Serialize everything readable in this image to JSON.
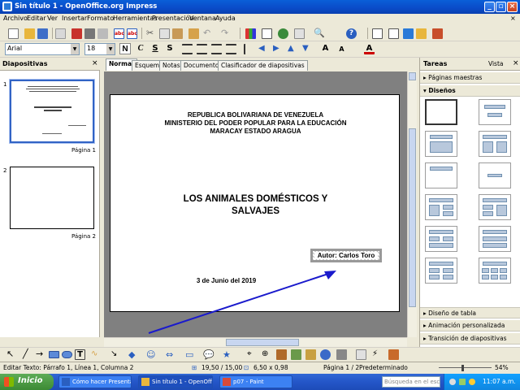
{
  "window": {
    "title": "Sin título 1 - OpenOffice.org Impress"
  },
  "menu": [
    "Archivo",
    "Editar",
    "Ver",
    "Insertar",
    "Formato",
    "Herramientas",
    "Presentación",
    "Ventana",
    "Ayuda"
  ],
  "format_bar": {
    "font_name": "Arial",
    "font_size": "18"
  },
  "slides_pane": {
    "title": "Diapositivas",
    "slides": [
      {
        "number": "1",
        "label": "Página 1"
      },
      {
        "number": "2",
        "label": "Página 2"
      }
    ]
  },
  "view_tabs": [
    "Normal",
    "Esquema",
    "Notas",
    "Documento",
    "Clasificador de diapositivas"
  ],
  "slide": {
    "header_lines": [
      "REPUBLICA BOLIVARIANA DE VENEZUELA",
      "MINISTERIO DEL PODER POPULAR PARA LA EDUCACIÓN",
      "MARACAY ESTADO ARAGUA"
    ],
    "title_lines": [
      "LOS ANIMALES DOMÉSTICOS Y",
      "SALVAJES"
    ],
    "author": "Autor: Carlos Toro",
    "date": "3 de Junio del 2019"
  },
  "task_pane": {
    "title": "Tareas",
    "view_label": "Vista",
    "sections": {
      "master_pages": "Páginas maestras",
      "layouts": "Diseños",
      "table_design": "Diseño de tabla",
      "custom_animation": "Animación personalizada",
      "slide_transition": "Transición de diapositivas"
    }
  },
  "status_bar": {
    "edit_text": "Editar Texto: Párrafo 1, Línea 1, Columna 2",
    "position": "19,50 / 15,00",
    "size": "6,50 x 0,98",
    "page": "Página 1 / 2",
    "style": "Predeterminado",
    "zoom": "54%"
  },
  "taskbar": {
    "start": "Inicio",
    "tasks": [
      {
        "label": "Cómo hacer Presenta..."
      },
      {
        "label": "Sin título 1 - OpenOffi..."
      },
      {
        "label": "p07 - Paint"
      }
    ],
    "search_placeholder": "Búsqueda en el escri",
    "clock": "11:07 a.m."
  },
  "colors": {
    "arrow": "#1a1acc",
    "titlebar": "#0a4bc8",
    "taskbar": "#2456c8",
    "start": "#3c8a34"
  }
}
